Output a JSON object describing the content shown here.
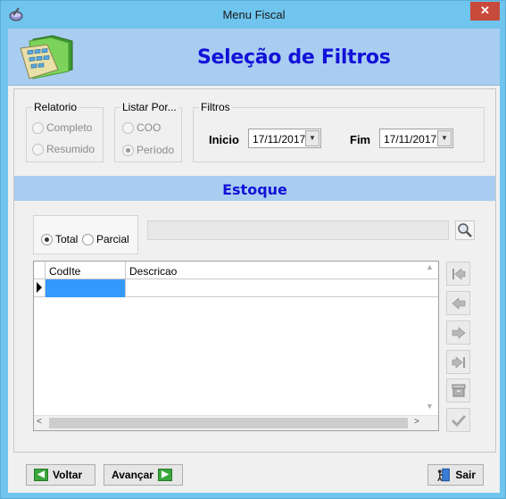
{
  "window": {
    "title": "Menu Fiscal",
    "close_glyph": "✕"
  },
  "header": {
    "title": "Seleção de Filtros",
    "icon": "calculator-folder-icon"
  },
  "relatorio": {
    "legend": "Relatorio",
    "options": [
      "Completo",
      "Resumido"
    ]
  },
  "listar_por": {
    "legend": "Listar Por...",
    "options": [
      "COO",
      "Período"
    ],
    "selected": "Período"
  },
  "filtros": {
    "legend": "Filtros",
    "inicio_label": "Inicio",
    "inicio_value": "17/11/2017",
    "fim_label": "Fim",
    "fim_value": "17/11/2017"
  },
  "estoque": {
    "title": "Estoque",
    "options": [
      "Total",
      "Parcial"
    ],
    "selected": "Total",
    "search_value": ""
  },
  "grid": {
    "columns": [
      "CodIte",
      "Descricao"
    ],
    "rows": [
      [
        "",
        ""
      ]
    ]
  },
  "nav_buttons": [
    "first-icon",
    "prior-icon",
    "next-icon",
    "last-icon",
    "cancel-icon",
    "post-icon"
  ],
  "buttons": {
    "voltar": "Voltar",
    "avancar": "Avançar",
    "sair": "Sair"
  },
  "colors": {
    "window_frame": "#6fc5ee",
    "header_bg": "#a9cdf1",
    "title_text": "#1212d8",
    "selected_cell": "#3399ff",
    "close_button": "#c74a3b"
  }
}
